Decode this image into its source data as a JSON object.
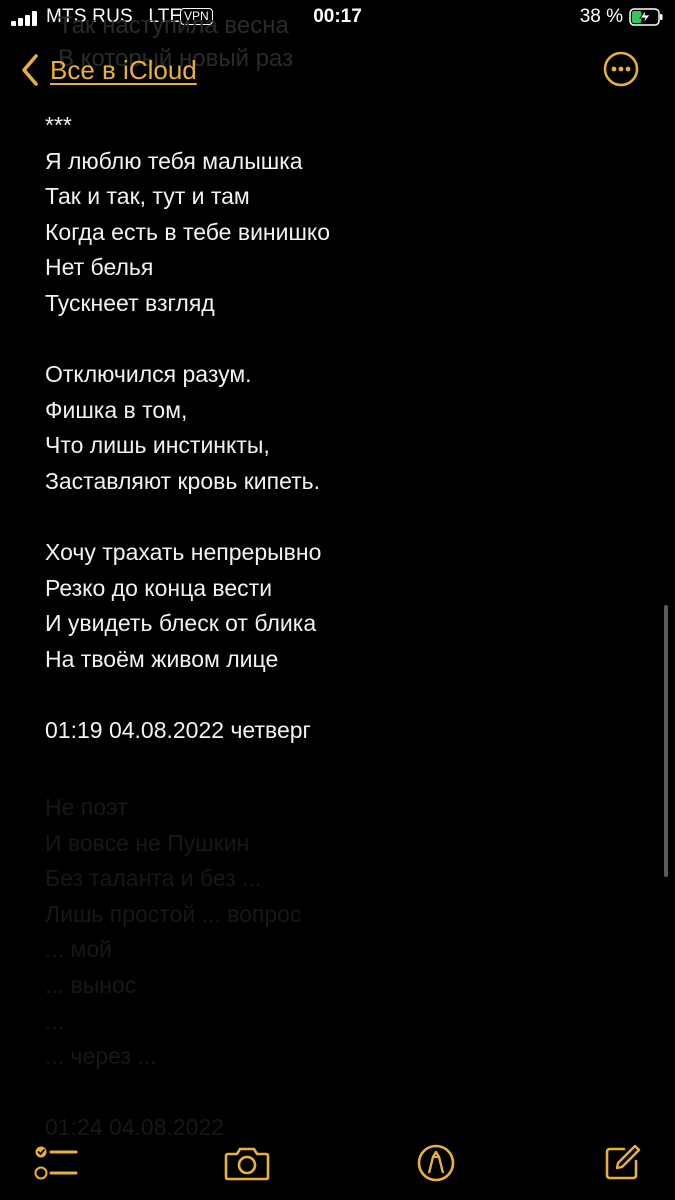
{
  "status_bar": {
    "carrier": "MTS RUS",
    "network": "LTE",
    "vpn": "VPN",
    "time": "00:17",
    "battery_percent": "38 %",
    "battery_level": 0.38,
    "signal_bars": 4
  },
  "nav": {
    "back_label": "Все в iCloud",
    "ghost_lines": [
      "Так наступила весна",
      "В который новый раз"
    ]
  },
  "note": {
    "lines": [
      "***",
      "Я люблю тебя малышка",
      "Так и так, тут и там",
      "Когда есть в тебе винишко",
      "Нет белья",
      "Тускнеет взгляд",
      "",
      "Отключился разум.",
      "Фишка в том,",
      "Что лишь инстинкты,",
      "Заставляют кровь кипеть.",
      "",
      "Хочу трахать непрерывно",
      "Резко до конца вести",
      "И увидеть блеск от блика",
      "На твоём живом лице",
      "",
      "01:19 04.08.2022 четверг"
    ],
    "faded_lines": [
      "Не поэт",
      "И вовсе не Пушкин",
      "Без таланта и без ...",
      "Лишь простой ... вопрос",
      "... мой",
      "... вынос",
      "...",
      "... через ...",
      "",
      "01:24 04.08.2022"
    ]
  },
  "toolbar": {
    "items": [
      "checklist",
      "camera",
      "markup",
      "compose"
    ]
  },
  "colors": {
    "accent": "#e9b233",
    "background": "#000000",
    "text": "#f2f2f2"
  }
}
